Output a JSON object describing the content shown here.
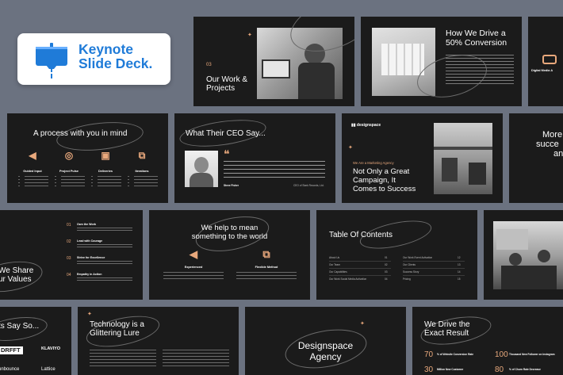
{
  "badge": {
    "title_line1": "Keynote",
    "title_line2": "Slide Deck."
  },
  "s_projects": {
    "num": "03",
    "title_l1": "Our Work &",
    "title_l2": "Projects"
  },
  "s_conversion": {
    "title_l1": "How We Drive a",
    "title_l2": "50% Conversion",
    "right_label": "Digital Media A"
  },
  "s_process": {
    "title": "A process with you in mind",
    "items": [
      {
        "label": "Guided Input"
      },
      {
        "label": "Project Pulse"
      },
      {
        "label": "Deliveries"
      },
      {
        "label": "Iterations"
      }
    ]
  },
  "s_ceo": {
    "title": "What Their CEO Say...",
    "name": "Steve Fisher",
    "meta": "CEO of Stark Records, Ltd."
  },
  "s_agency": {
    "brand": "designspace",
    "kicker": "We Are a Marketing Agency",
    "title_l1": "Not Only a Great",
    "title_l2": "Campaign, It",
    "title_l3": "Comes to Success"
  },
  "s_more": {
    "l1": "More",
    "l2": "succe",
    "l3": "an"
  },
  "s_values": {
    "title_l1": "We Share",
    "title_l2": "ur Values",
    "items": [
      {
        "num": "01",
        "label": "Own the Work"
      },
      {
        "num": "02",
        "label": "Lead with Courage"
      },
      {
        "num": "03",
        "label": "Strive for Excellence"
      },
      {
        "num": "04",
        "label": "Empathy in Action"
      }
    ]
  },
  "s_mean": {
    "title_l1": "We help to mean",
    "title_l2": "something to the world",
    "left_label": "Experienced",
    "right_label": "Flexible Method"
  },
  "s_toc": {
    "title": "Table Of Contents",
    "left": [
      {
        "label": "About Us",
        "num": "01"
      },
      {
        "label": "Our Team",
        "num": "02"
      },
      {
        "label": "Our Capabilities",
        "num": "03"
      },
      {
        "label": "Our Work Social Media Activation",
        "num": "04"
      }
    ],
    "right": [
      {
        "label": "Our Work Event Activation",
        "num": "12"
      },
      {
        "label": "Our Clients",
        "num": "13"
      },
      {
        "label": "Success Story",
        "num": "14"
      },
      {
        "label": "Pricing",
        "num": "15"
      }
    ]
  },
  "s_says": {
    "title": "ts Say So...",
    "logo1": "DRFFT",
    "logo2": "KLAVIYO",
    "logo3": "unbounce",
    "logo4": "Lattice"
  },
  "s_tech": {
    "title_l1": "Technology is a",
    "title_l2": "Glittering Lure"
  },
  "s_dsagency": {
    "title_l1": "Designspace",
    "title_l2": "Agency"
  },
  "s_exact": {
    "title_l1": "We Drive the",
    "title_l2": "Exact Result",
    "stats": [
      {
        "value": "70",
        "label": "% of Website Conversion Rate"
      },
      {
        "value": "100",
        "label": "Thousand New Follower on Instagram"
      },
      {
        "value": "30",
        "label": "Million New Customer"
      },
      {
        "value": "80",
        "label": "% of Churn Rate Decrease"
      }
    ]
  },
  "colors": {
    "accent": "#e8a87c",
    "brand_blue": "#1f7bd8",
    "slide_bg": "#1b1b1b",
    "page_bg": "#6b7280"
  }
}
